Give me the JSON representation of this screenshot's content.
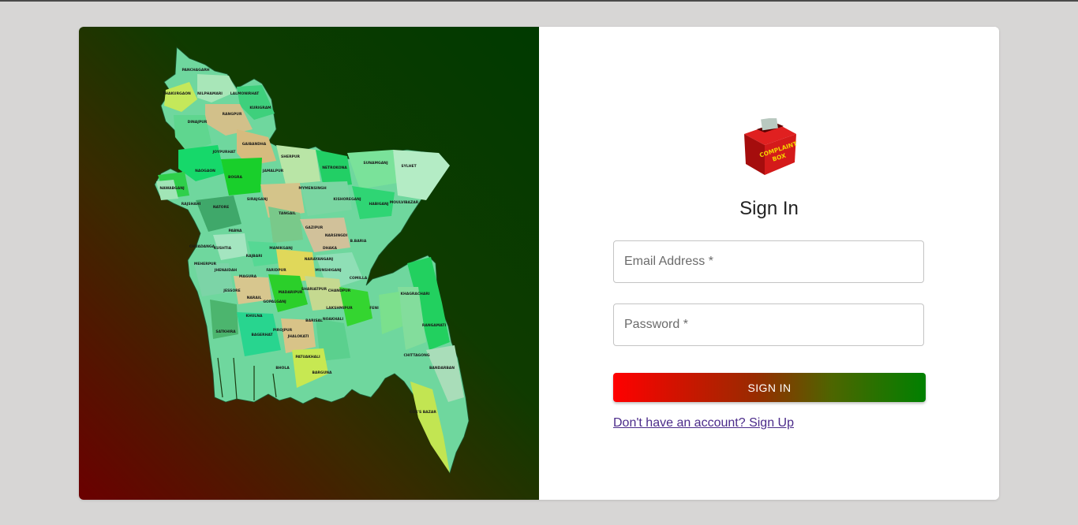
{
  "auth": {
    "title": "Sign In",
    "email_placeholder": "Email Address *",
    "password_placeholder": "Password *",
    "signin_label": "SIGN IN",
    "signup_link": "Don't have an account? Sign Up"
  },
  "logo": {
    "line1": "COMPLAINT",
    "line2": "BOX"
  },
  "map": {
    "districts": [
      "PANCHAGARH",
      "THAKURGAON",
      "NILPHAMARI",
      "LALMONIRHAT",
      "KURIGRAM",
      "RANGPUR",
      "DINAJPUR",
      "GAIBANDHA",
      "JOYPURHAT",
      "NAOGAON",
      "BOGRA",
      "JAMALPUR",
      "SHERPUR",
      "NETROKONA",
      "SUNAMGANJ",
      "SYLHET",
      "NAWABGANJ",
      "RAJSHAHI",
      "NATORE",
      "SIRAJGANJ",
      "MYMENSINGH",
      "KISHOREGANJ",
      "HABIGANJ",
      "MOULVIBAZAR",
      "TANGAIL",
      "GAZIPUR",
      "NARSINGDI",
      "B.BARIA",
      "PABNA",
      "KUSHTIA",
      "MANIKGANJ",
      "DHAKA",
      "NARAYANGANJ",
      "CHUADANGA",
      "MEHERPUR",
      "RAJBARI",
      "JHENAIDAH",
      "MAGURA",
      "FARIDPUR",
      "MUNSHIGANJ",
      "COMILLA",
      "KHAGRACHARI",
      "JESSORE",
      "NARAIL",
      "GOPALGANJ",
      "MADARIPUR",
      "SHARIATPUR",
      "CHANDPUR",
      "LAKSHMIPUR",
      "FENI",
      "RANGAMATI",
      "KHULNA",
      "SATKHIRA",
      "BAGERHAT",
      "PIROJPUR",
      "JHALOKATI",
      "BARISAL",
      "NOAKHALI",
      "BHOLA",
      "PATUAKHALI",
      "BARGUNA",
      "CHITTAGONG",
      "BANDARBAN",
      "COX'S BAZAR"
    ]
  },
  "colors": {
    "accent_start": "#ff0000",
    "accent_end": "#008000",
    "link": "#4b2b8a",
    "background": "#d7d6d5"
  }
}
